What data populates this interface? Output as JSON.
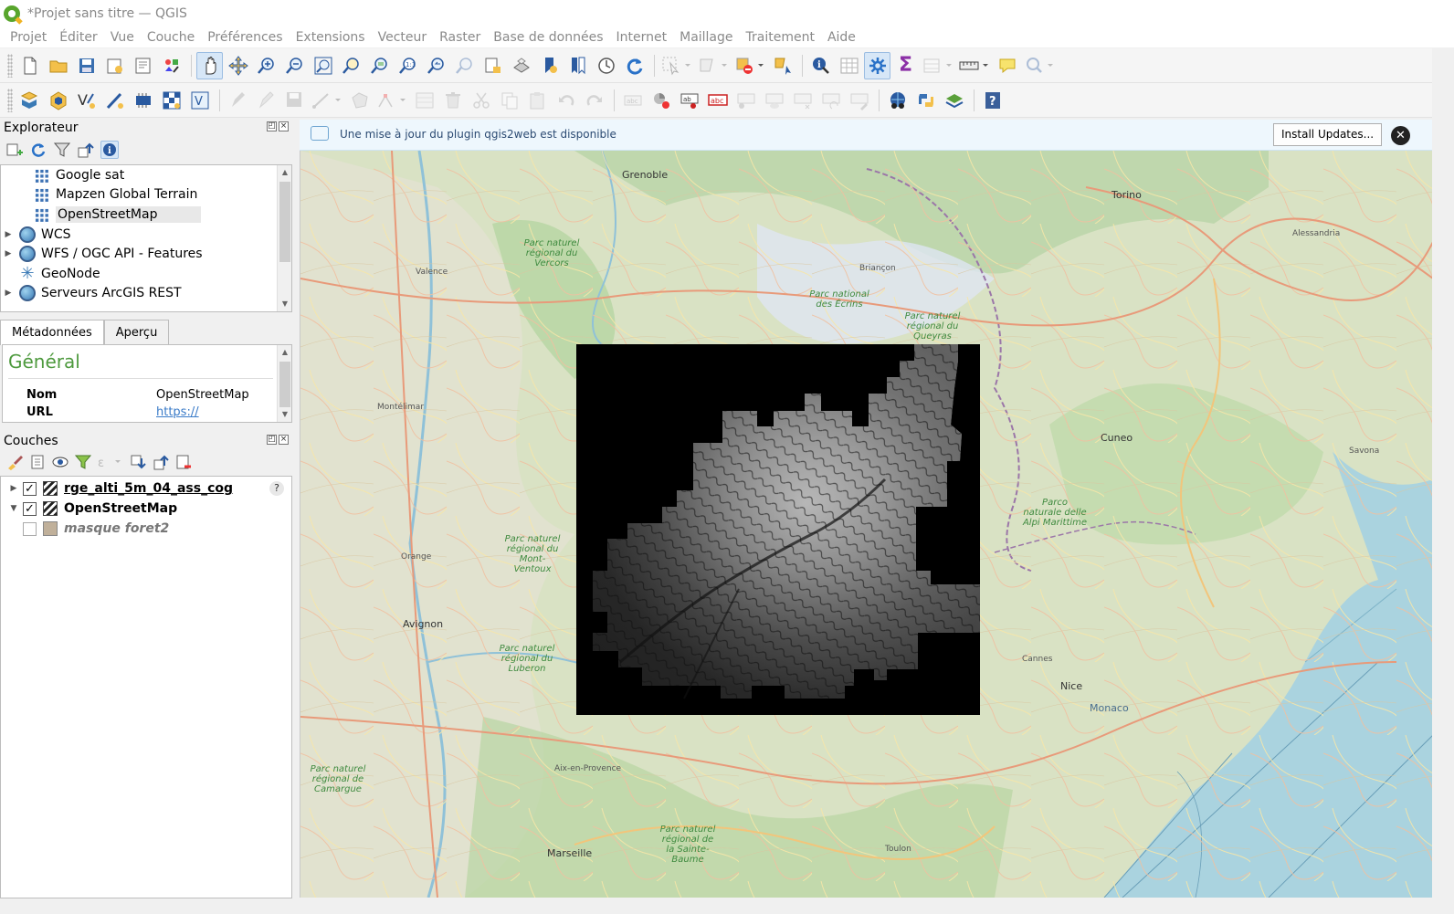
{
  "window": {
    "title": "*Projet sans titre — QGIS"
  },
  "menu": [
    "Projet",
    "Éditer",
    "Vue",
    "Couche",
    "Préférences",
    "Extensions",
    "Vecteur",
    "Raster",
    "Base de données",
    "Internet",
    "Maillage",
    "Traitement",
    "Aide"
  ],
  "explorer": {
    "title": "Explorateur",
    "items": [
      {
        "label": "Google sat",
        "icon": "xyz-tile-icon"
      },
      {
        "label": "Mapzen Global Terrain",
        "icon": "xyz-tile-icon"
      },
      {
        "label": "OpenStreetMap",
        "icon": "xyz-tile-icon",
        "selected": true
      },
      {
        "label": "WCS",
        "icon": "globe-icon"
      },
      {
        "label": "WFS / OGC API - Features",
        "icon": "globe-icon"
      },
      {
        "label": "GeoNode",
        "icon": "geonode-icon"
      },
      {
        "label": "Serveurs ArcGIS REST",
        "icon": "globe-icon"
      }
    ]
  },
  "meta_tabs": [
    "Métadonnées",
    "Aperçu"
  ],
  "metadata": {
    "heading": "Général",
    "rows": [
      {
        "key": "Nom",
        "value": "OpenStreetMap"
      },
      {
        "key": "URL",
        "value": "https://"
      }
    ]
  },
  "layers": {
    "title": "Couches",
    "items": [
      {
        "label": "rge_alti_5m_04_ass_cog",
        "checked": "✓"
      },
      {
        "label": "OpenStreetMap",
        "checked": "✓"
      },
      {
        "label": "masque foret2",
        "checked": ""
      }
    ]
  },
  "notification": {
    "text": "Une mise à jour du plugin qgis2web est disponible",
    "button": "Install Updates...",
    "close": "✕"
  },
  "map": {
    "cities": [
      "Torino",
      "Grenoble",
      "Briançon",
      "Valence",
      "Cuneo",
      "Avignon",
      "Nice",
      "Monaco",
      "Marseille",
      "Aix-en-Provence",
      "Savona",
      "Alessandria",
      "Montélimar",
      "Orange",
      "Cannes",
      "Toulon"
    ],
    "parks": [
      "Parc naturel régional du Vercors",
      "Parc national des Écrins",
      "Parc naturel régional du Queyras",
      "Parc naturel régional du Mont-Ventoux",
      "Parc naturel régional du Luberon",
      "Parc naturel régional de la Sainte-Baume",
      "Parc naturel régional de Camargue",
      "Parco naturale delle Alpi Marittime"
    ]
  },
  "colors": {
    "park_green": "#3f8a3f",
    "sea": "#aad3df",
    "land": "#e7e4da",
    "forest": "#add19e",
    "accent_blue": "#3a7ab5"
  }
}
